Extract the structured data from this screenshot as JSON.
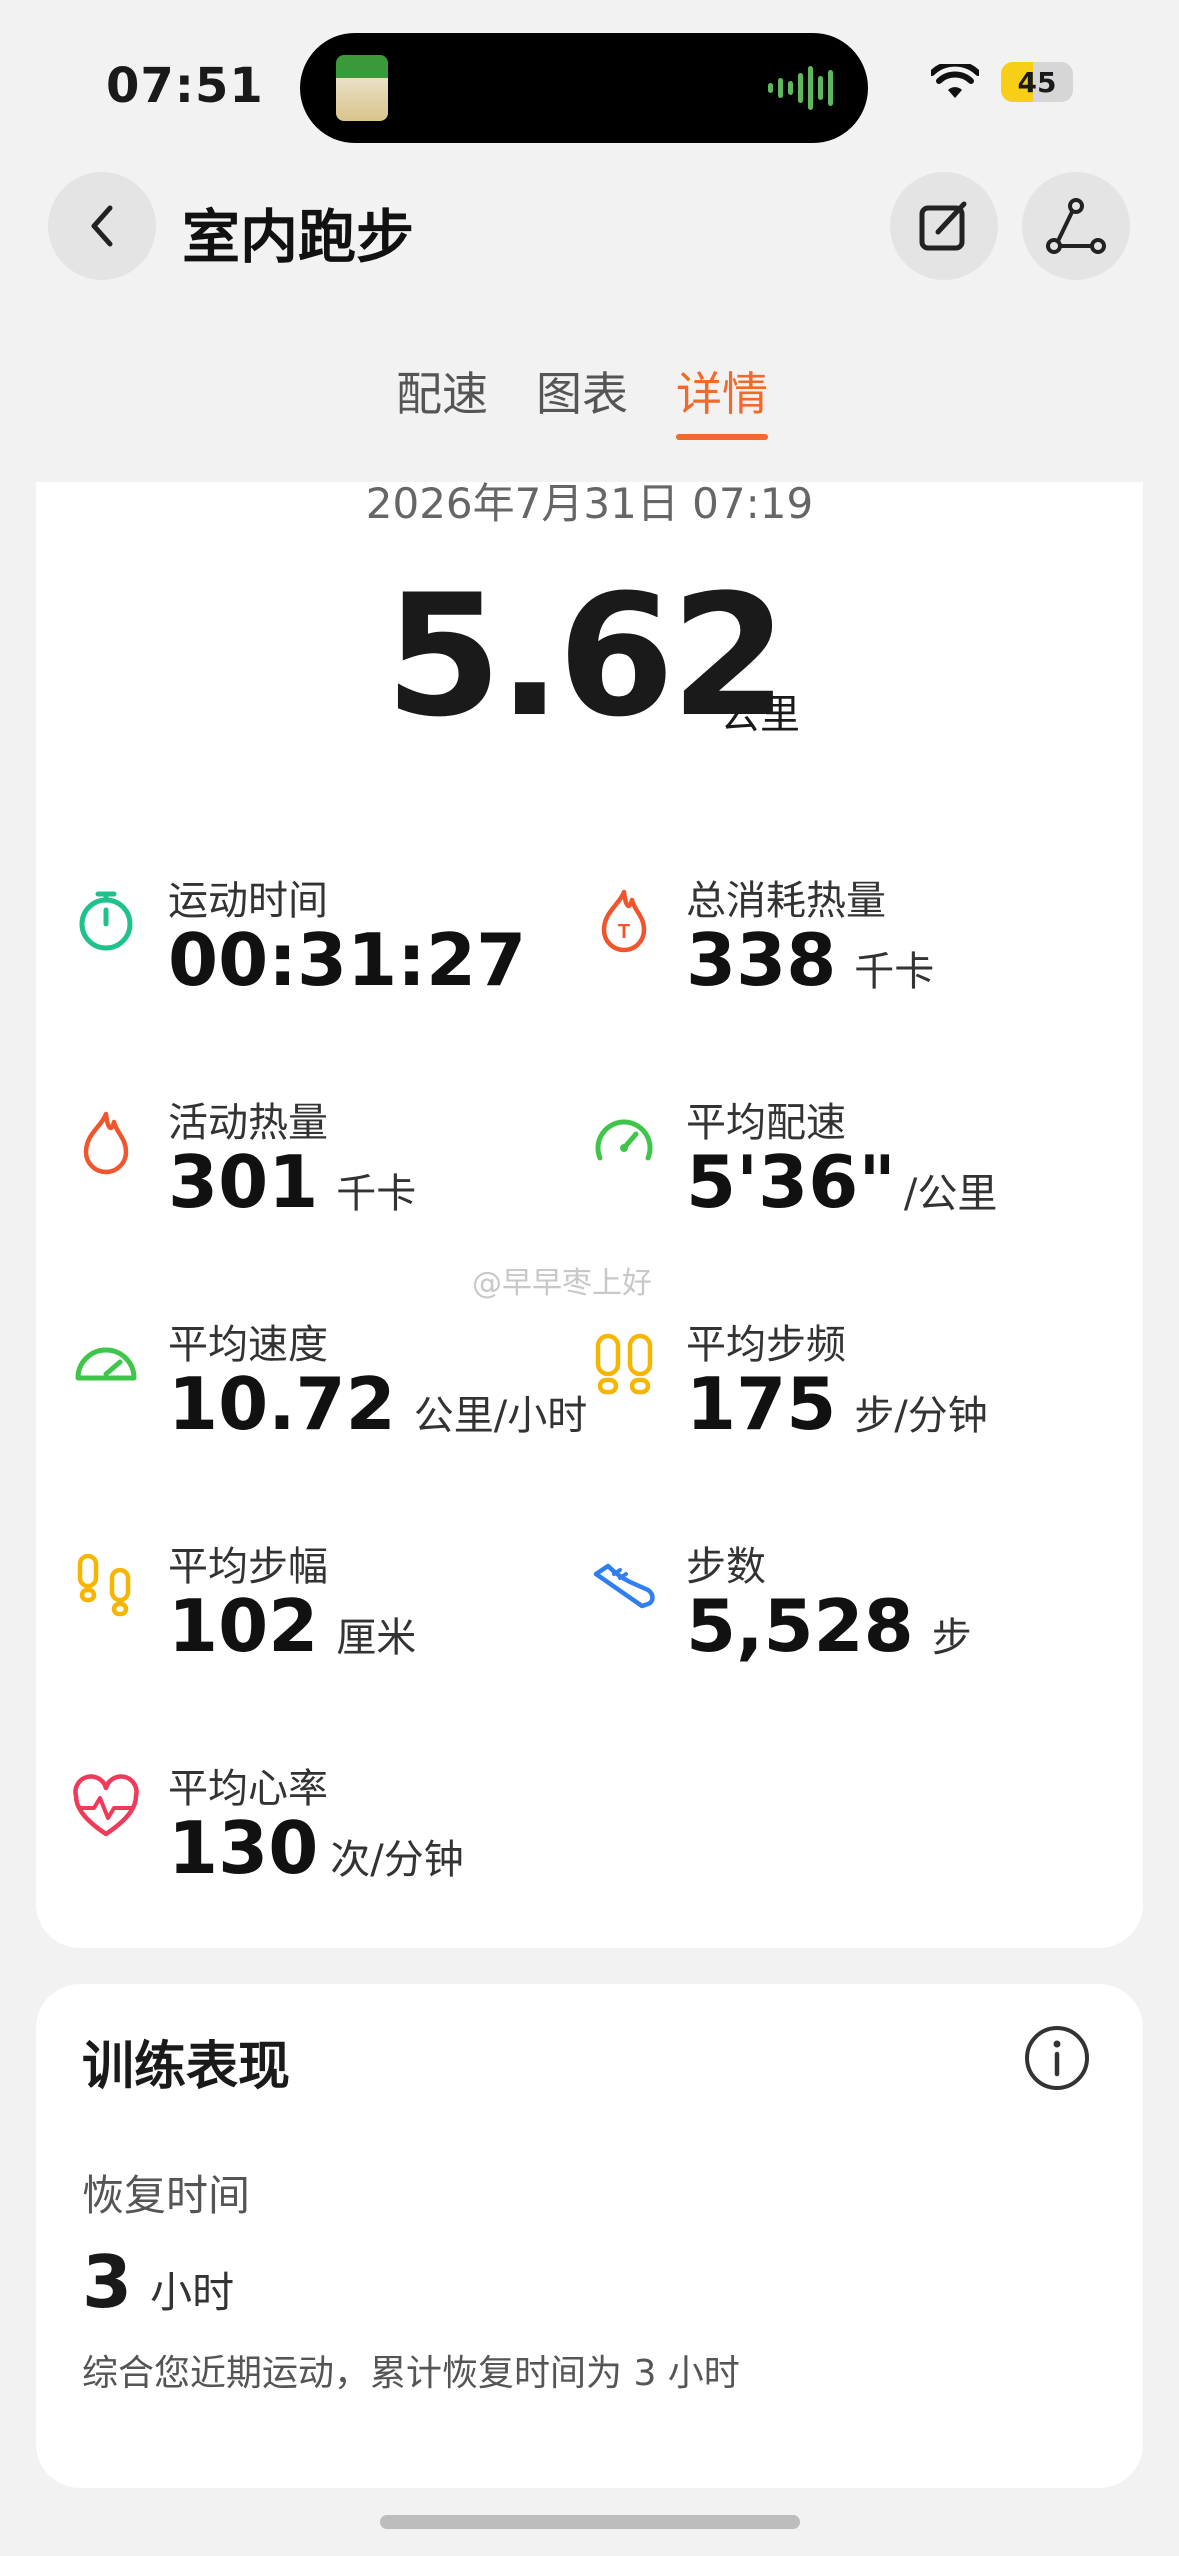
{
  "status_bar": {
    "time": "07:51",
    "battery": "45",
    "battery_level_percent": 45
  },
  "header": {
    "title": "室内跑步",
    "back_icon": "chevron-left-icon",
    "edit_icon": "edit-icon",
    "share_icon": "share-icon"
  },
  "tabs": [
    {
      "label": "配速",
      "active": false
    },
    {
      "label": "图表",
      "active": false
    },
    {
      "label": "详情",
      "active": true
    }
  ],
  "summary": {
    "date": "2026年7月31日 07:19",
    "distance": "5.62",
    "distance_unit": "公里"
  },
  "metrics": [
    {
      "label": "运动时间",
      "value": "00:31:27",
      "unit": "",
      "icon": "stopwatch-icon",
      "color": "#1fc28a"
    },
    {
      "label": "总消耗热量",
      "value": "338",
      "unit": "千卡",
      "icon": "calorie-total-icon",
      "color": "#f0552d"
    },
    {
      "label": "活动热量",
      "value": "301",
      "unit": "千卡",
      "icon": "flame-icon",
      "color": "#f0552d"
    },
    {
      "label": "平均配速",
      "value": "5'36\"",
      "unit": "/公里",
      "icon": "pace-gauge-icon",
      "color": "#3fc64a"
    },
    {
      "label": "平均速度",
      "value": "10.72",
      "unit": "公里/小时",
      "icon": "speedometer-icon",
      "color": "#3fc64a"
    },
    {
      "label": "平均步频",
      "value": "175",
      "unit": "步/分钟",
      "icon": "footprints-icon",
      "color": "#f7b500"
    },
    {
      "label": "平均步幅",
      "value": "102",
      "unit": "厘米",
      "icon": "stride-icon",
      "color": "#f7b500"
    },
    {
      "label": "步数",
      "value": "5,528",
      "unit": "步",
      "icon": "shoe-icon",
      "color": "#2f7ff0"
    },
    {
      "label": "平均心率",
      "value": "130",
      "unit": "次/分钟",
      "icon": "heart-rate-icon",
      "color": "#f03a5a"
    }
  ],
  "watermark": "@早早枣上好",
  "training": {
    "title": "训练表现",
    "recovery_label": "恢复时间",
    "recovery_value": "3",
    "recovery_unit": "小时",
    "recovery_note": "综合您近期运动，累计恢复时间为 3 小时"
  },
  "colors": {
    "accent": "#f06a2a"
  }
}
